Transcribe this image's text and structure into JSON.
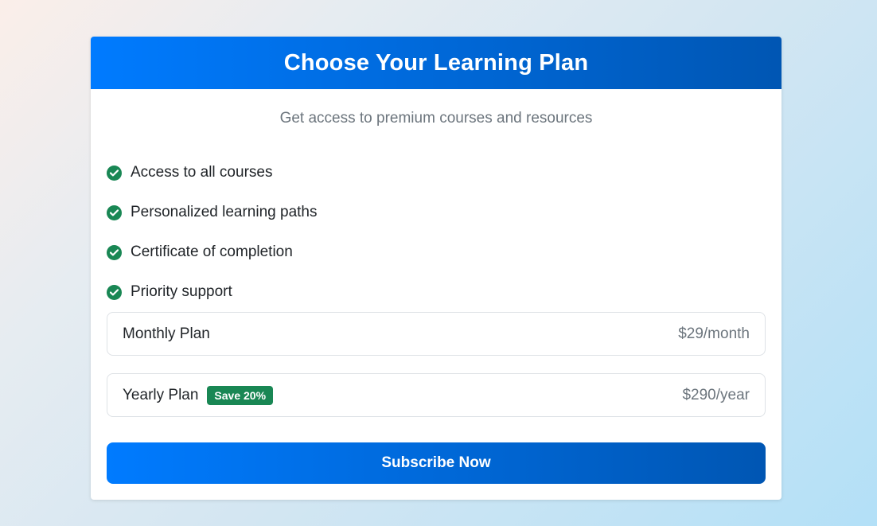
{
  "header": {
    "title": "Choose Your Learning Plan"
  },
  "subtitle": "Get access to premium courses and resources",
  "features": [
    {
      "label": "Access to all courses",
      "icon": "check-circle-icon"
    },
    {
      "label": "Personalized learning paths",
      "icon": "check-circle-icon"
    },
    {
      "label": "Certificate of completion",
      "icon": "check-circle-icon"
    },
    {
      "label": "Priority support",
      "icon": "check-circle-icon"
    }
  ],
  "plans": [
    {
      "name": "Monthly Plan",
      "price": "$29/month",
      "badge": ""
    },
    {
      "name": "Yearly Plan",
      "price": "$290/year",
      "badge": "Save 20%"
    }
  ],
  "subscribe_label": "Subscribe Now",
  "colors": {
    "primary": "#007bff",
    "primary_dark": "#0056b3",
    "success": "#198754",
    "muted_text": "#6c757d",
    "body_text": "#212529"
  }
}
